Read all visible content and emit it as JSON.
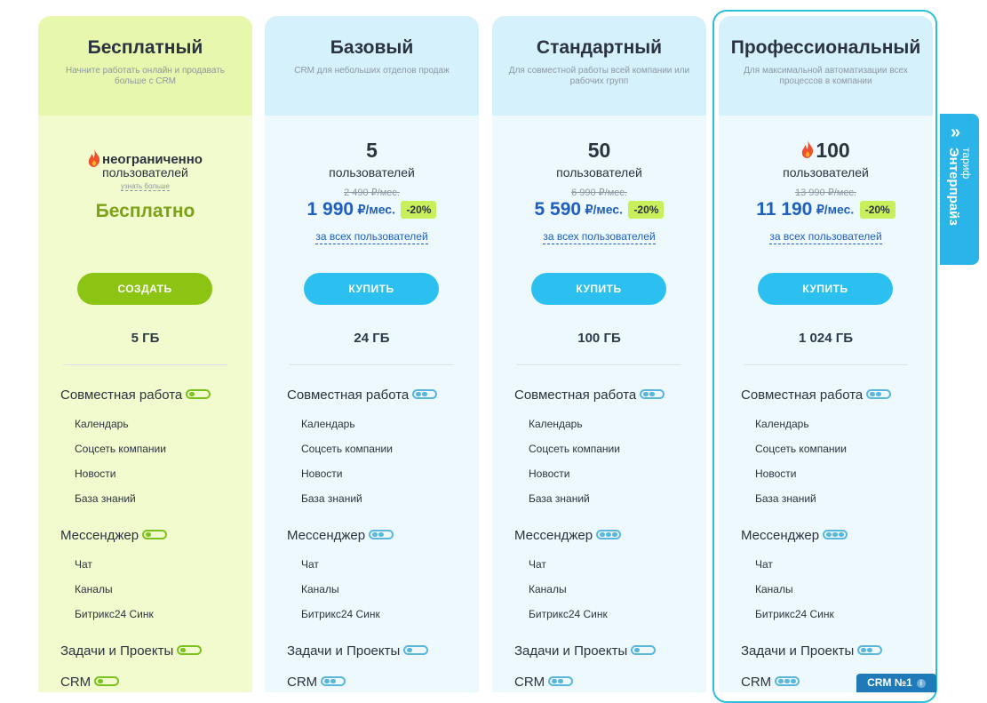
{
  "plans": [
    {
      "title": "Бесплатный",
      "subtitle": "Начните работать онлайн и продавать больше с CRM",
      "unlimited": "неограниченно",
      "users_label": "пользователей",
      "learn_more": "узнать больше",
      "price": "Бесплатно",
      "button": "СОЗДАТЬ",
      "storage": "5 ГБ",
      "toggles": [
        "1",
        "1",
        "1",
        "1"
      ]
    },
    {
      "title": "Базовый",
      "subtitle": "CRM для небольших отделов продаж",
      "qty": "5",
      "users_label": "пользователей",
      "old_price": "2 490 ₽/мес.",
      "price": "1 990",
      "per": "₽/мес.",
      "discount": "-20%",
      "all_users": "за всех пользователей",
      "button": "КУПИТЬ",
      "storage": "24 ГБ",
      "toggles": [
        "2",
        "2",
        "1",
        "2"
      ]
    },
    {
      "title": "Стандартный",
      "subtitle": "Для совместной работы всей компании или рабочих групп",
      "qty": "50",
      "users_label": "пользователей",
      "old_price": "6 990 ₽/мес.",
      "price": "5 590",
      "per": "₽/мес.",
      "discount": "-20%",
      "all_users": "за всех пользователей",
      "button": "КУПИТЬ",
      "storage": "100 ГБ",
      "toggles": [
        "2",
        "3",
        "1",
        "2"
      ]
    },
    {
      "title": "Профессиональный",
      "subtitle": "Для максимальной автоматизации всех процессов в компании",
      "qty": "100",
      "users_label": "пользователей",
      "old_price": "13 990 ₽/мес.",
      "price": "11 190",
      "per": "₽/мес.",
      "discount": "-20%",
      "all_users": "за всех пользователей",
      "button": "КУПИТЬ",
      "storage": "1 024 ГБ",
      "toggles": [
        "2",
        "3",
        "2",
        "3"
      ]
    }
  ],
  "features": {
    "collab": "Совместная работа",
    "collab_items": [
      "Календарь",
      "Соцсеть компании",
      "Новости",
      "База знаний"
    ],
    "messenger": "Мессенджер",
    "messenger_items": [
      "Чат",
      "Каналы",
      "Битрикс24 Синк"
    ],
    "tasks": "Задачи и Проекты",
    "crm": "CRM"
  },
  "enterprise_tab": {
    "small": "тариф",
    "big": "Энтерпрайз"
  },
  "crm_badge": "CRM №1",
  "colors": {
    "free_accent": "#8cc413",
    "blue_accent": "#2bc0ef",
    "price_blue": "#1e5fc0",
    "discount_bg": "#c9f05a"
  }
}
